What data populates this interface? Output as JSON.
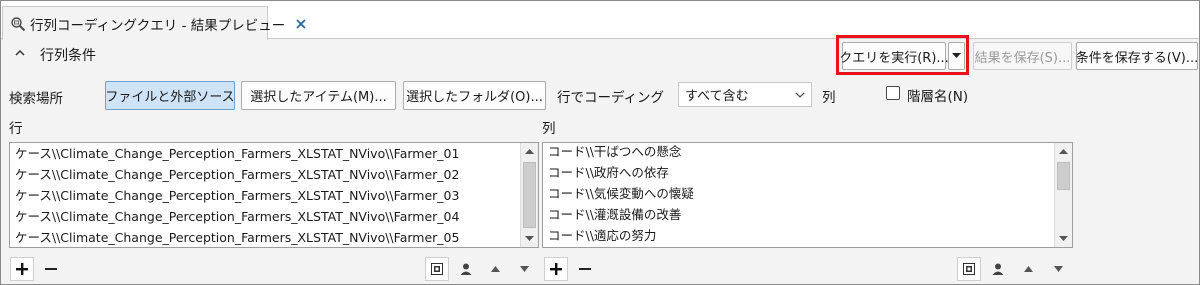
{
  "tab": {
    "title": "行列コーディングクエリ - 結果プレビュー",
    "icon": "magnifier-query-icon",
    "close_icon": "close-icon"
  },
  "section": {
    "title": "行列条件",
    "collapse_icon": "chevron-up-icon"
  },
  "actions": {
    "run_query": "クエリを実行(R)...",
    "run_dropdown_icon": "dropdown-arrow-icon",
    "save_results": "結果を保存(S)...",
    "save_criteria": "条件を保存する(V)...",
    "highlight_color": "#e8121d"
  },
  "search": {
    "label": "検索場所",
    "buttons": [
      "ファイルと外部ソース",
      "選択したアイテム(M)...",
      "選択したフォルダ(O)..."
    ],
    "selected_index": 0
  },
  "coding": {
    "label": "行でコーディング",
    "selected": "すべて含む",
    "column_label": "列",
    "hierarchy_label": "階層名(N)",
    "hierarchy_checked": false
  },
  "rows": {
    "label": "行",
    "items": [
      "ケース\\\\Climate_Change_Perception_Farmers_XLSTAT_NVivo\\\\Farmer_01",
      "ケース\\\\Climate_Change_Perception_Farmers_XLSTAT_NVivo\\\\Farmer_02",
      "ケース\\\\Climate_Change_Perception_Farmers_XLSTAT_NVivo\\\\Farmer_03",
      "ケース\\\\Climate_Change_Perception_Farmers_XLSTAT_NVivo\\\\Farmer_04",
      "ケース\\\\Climate_Change_Perception_Farmers_XLSTAT_NVivo\\\\Farmer_05"
    ]
  },
  "columns": {
    "label": "列",
    "items": [
      "コード\\\\干ばつへの懸念",
      "コード\\\\政府への依存",
      "コード\\\\気候変動への懐疑",
      "コード\\\\灌漑設備の改善",
      "コード\\\\適応の努力"
    ]
  },
  "toolbar_icons": [
    "add-icon",
    "remove-icon",
    "select-items-icon",
    "person-icon",
    "move-up-icon",
    "move-down-icon"
  ]
}
